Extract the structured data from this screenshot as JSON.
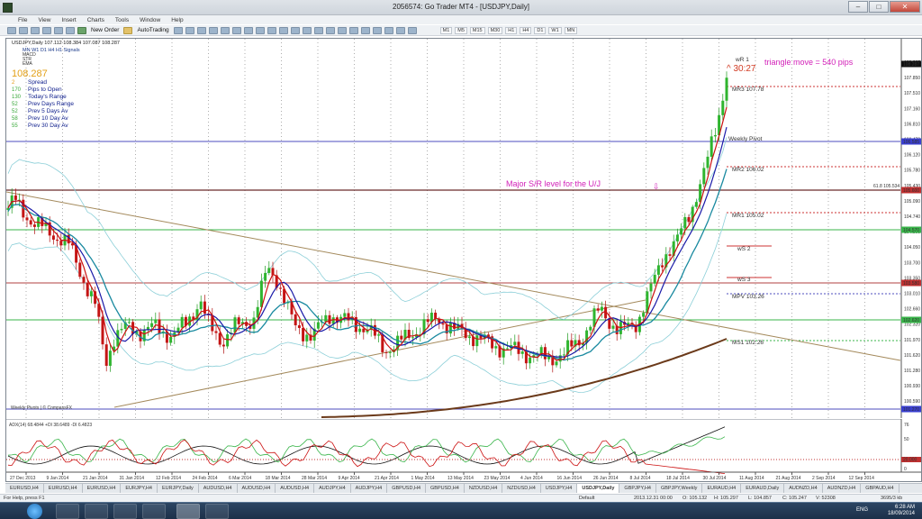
{
  "window": {
    "title": "2056574: Go Trader MT4 - [USDJPY,Daily]"
  },
  "menu": [
    "File",
    "View",
    "Insert",
    "Charts",
    "Tools",
    "Window",
    "Help"
  ],
  "toolbar": {
    "new_order": "New Order",
    "autotrading": "AutoTrading",
    "timeframes": [
      "M1",
      "M5",
      "M15",
      "M30",
      "H1",
      "H4",
      "D1",
      "W1",
      "MN"
    ]
  },
  "chart": {
    "header": "USDJPY,Daily  107.112 108.384 107.087 108.287",
    "indicator_header": "ADX(14) 68.4844 +DI 38.6489 -DI 6.4823",
    "watermark": "Weekly Pivots | © CompassFX",
    "ann_triangle": "triangle move = 540 pips",
    "ann_sr": "Major S/R level for the U/J",
    "ann_arrow": "⇩",
    "countdown": "^ 30:27",
    "fib_label": "61.8 105.534",
    "pivots": {
      "wr1": "wR 1",
      "mr3": "MR3  107.78",
      "weekly_pivot": "Weekly Pivot",
      "mr2": "MR2  106.02",
      "mr1": "MR1  105.02",
      "ws2": "wS 2",
      "ws3": "wS 3",
      "mpv": "MPV  103.26",
      "ms1": "MS1  102.26"
    },
    "price_axis": [
      "108.287",
      "107.850",
      "107.510",
      "107.160",
      "106.810",
      "106.470",
      "106.120",
      "105.780",
      "105.430",
      "105.090",
      "104.740",
      "104.390",
      "104.050",
      "103.700",
      "103.350",
      "103.010",
      "102.660",
      "102.320",
      "101.970",
      "101.620",
      "101.280",
      "100.930",
      "100.590"
    ],
    "price_highlights": [
      {
        "label": "108.287",
        "bg": "#111111"
      },
      {
        "label": "106.585",
        "bg": "#3a3fd0"
      },
      {
        "label": "105.600",
        "bg": "#c03030"
      },
      {
        "label": "104.570",
        "bg": "#39b54a"
      },
      {
        "label": "103.580",
        "bg": "#c03030"
      },
      {
        "label": "102.620",
        "bg": "#39b54a"
      },
      {
        "label": "101.270",
        "bg": "#3a3fd0"
      }
    ],
    "indicator_axis": [
      "76",
      "50",
      "20",
      "0"
    ],
    "ind_highlight": {
      "label": "20.000",
      "bg": "#c03030"
    },
    "time_axis": [
      "27 Dec 2013",
      "9 Jan 2014",
      "21 Jan 2014",
      "31 Jan 2014",
      "12 Feb 2014",
      "24 Feb 2014",
      "6 Mar 2014",
      "18 Mar 2014",
      "28 Mar 2014",
      "9 Apr 2014",
      "21 Apr 2014",
      "1 May 2014",
      "13 May 2014",
      "23 May 2014",
      "4 Jun 2014",
      "16 Jun 2014",
      "26 Jun 2014",
      "8 Jul 2014",
      "18 Jul 2014",
      "30 Jul 2014",
      "11 Aug 2014",
      "21 Aug 2014",
      "2 Sep 2014",
      "12 Sep 2014"
    ]
  },
  "infobox": {
    "symbol_line": "MN  W1  D1  H4  H1",
    "signals_label": "Signals",
    "signals": [
      "MACD",
      "STR",
      "EMA"
    ],
    "price": "108.287",
    "rows": [
      {
        "n": "2",
        "label": "Spread",
        "cls": "spread"
      },
      {
        "n": "170",
        "label": "Pips to Open"
      },
      {
        "n": "130",
        "label": "Today's Range"
      },
      {
        "n": "52",
        "label": "Prev Days Range"
      },
      {
        "n": "52",
        "label": "Prev 5 Days Av"
      },
      {
        "n": "58",
        "label": "Prev 10 Day Av"
      },
      {
        "n": "55",
        "label": "Prev 30 Day Av"
      }
    ]
  },
  "symbol_tabs": [
    "EURUSD,H4",
    "EURUSD,H4",
    "EURUSD,H4",
    "EURJPY,H4",
    "EURJPY,Daily",
    "AUDUSD,H4",
    "AUDUSD,H4",
    "AUDUSD,H4",
    "AUDJPY,H4",
    "AUDJPY,H4",
    "GBPUSD,H4",
    "GBPUSD,H4",
    "NZDUSD,H4",
    "NZDUSD,H4",
    "USDJPY,H4",
    "USDJPY,Daily",
    "GBPJPY,H4",
    "GBPJPY,Weekly",
    "EURAUD,H4",
    "EURAUD,Daily",
    "AUDNZD,H4",
    "AUDNZD,H4",
    "GBPAUD,H4"
  ],
  "active_tab": "USDJPY,Daily",
  "status": {
    "help": "For Help, press F1",
    "profile": "Default",
    "datetime": "2013.12.31 00:00",
    "o": "O: 105.132",
    "h": "H: 105.297",
    "l": "L: 104.857",
    "c": "C: 105.247",
    "v": "V: 52308",
    "bars": "3695/3 kb"
  },
  "taskbar": {
    "lang": "ENG",
    "time": "6:28 AM",
    "date": "18/09/2014"
  },
  "colors": {
    "ema_fast": "#cc1111",
    "ema_slow": "#1a1aa8",
    "ema_mid": "#1a8aa0",
    "ma_long": "#6b3a1a",
    "bb": "#8ccfd8",
    "trend": "#a48a5c",
    "sr": "#5050cc",
    "annot": "#d21fb8"
  }
}
